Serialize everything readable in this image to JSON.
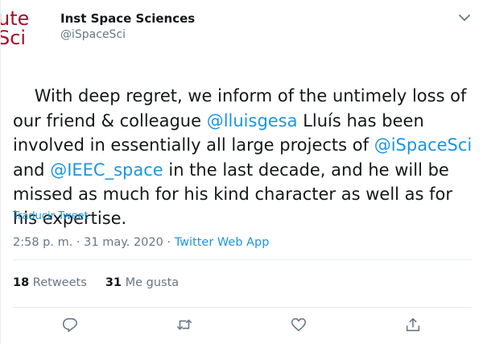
{
  "author": {
    "avatar_line1": "ute",
    "avatar_line2": "Sci",
    "name": "Inst Space Sciences",
    "handle": "@iSpaceSci"
  },
  "tweet": {
    "segments": [
      {
        "text": "With deep regret, we inform of the untimely loss of our friend & colleague ",
        "mention": false
      },
      {
        "text": "@lluisgesa",
        "mention": true
      },
      {
        "text": " Lluís has been involved in essentially all large projects of ",
        "mention": false
      },
      {
        "text": "@iSpaceSci",
        "mention": true
      },
      {
        "text": " and ",
        "mention": false
      },
      {
        "text": "@IEEC_space",
        "mention": true
      },
      {
        "text": " in the last decade, and he will be missed as much for his kind character as well as for his expertise.",
        "mention": false
      }
    ],
    "translate_label": "Traducir Tweet",
    "time": "2:58 p. m.",
    "separator": " · ",
    "date": "31 may. 2020",
    "app": "Twitter Web App"
  },
  "stats": {
    "retweets_count": "18",
    "retweets_label": "Retweets",
    "likes_count": "31",
    "likes_label": "Me gusta"
  },
  "colors": {
    "link": "#1b95e0",
    "secondary": "#657786",
    "avatar_brand": "#a5122b"
  },
  "icons": {
    "caret": "chevron-down-icon",
    "reply": "reply-icon",
    "retweet": "retweet-icon",
    "like": "heart-icon",
    "share": "share-icon"
  }
}
